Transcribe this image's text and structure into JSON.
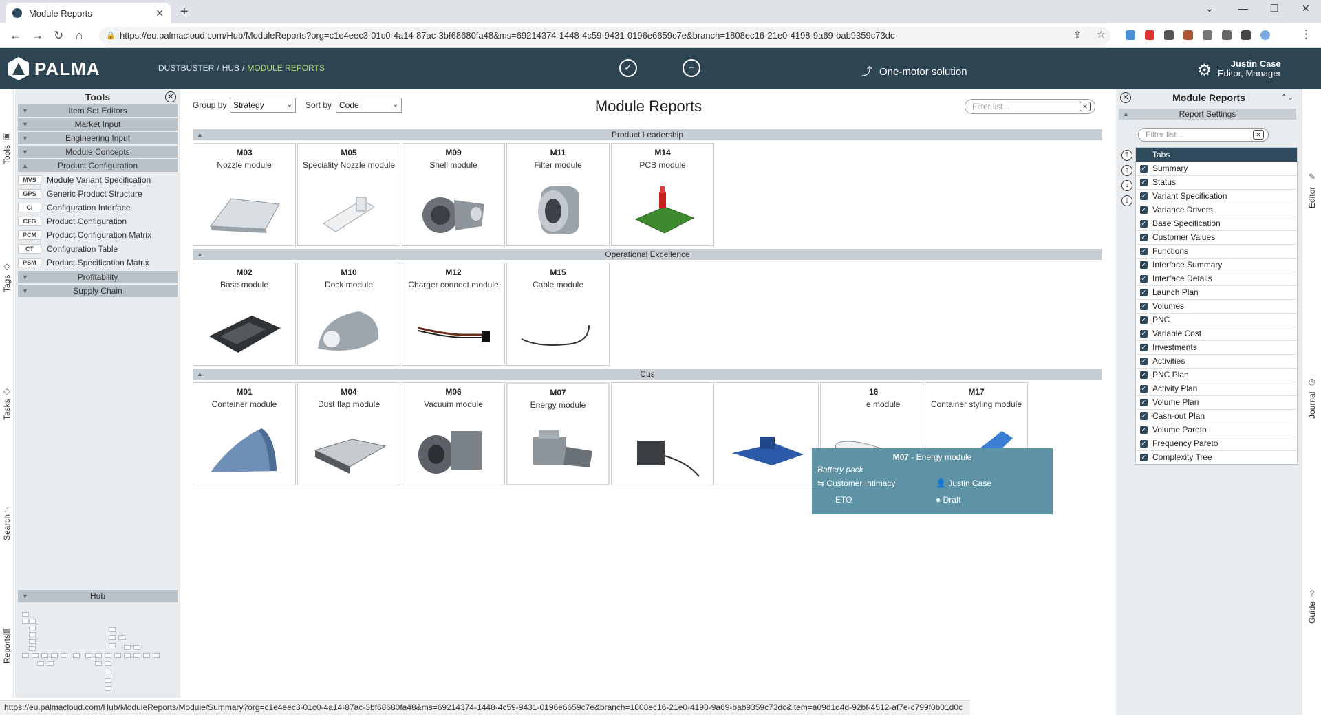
{
  "browser": {
    "tab_title": "Module Reports",
    "url": "https://eu.palmacloud.com/Hub/ModuleReports?org=c1e4eec3-01c0-4a14-87ac-3bf68680fa48&ms=69214374-1448-4c59-9431-0196e6659c7e&branch=1808ec16-21e0-4198-9a69-bab9359c73dc"
  },
  "header": {
    "logo": "PALMA",
    "breadcrumb": [
      "DUSTBUSTER",
      "HUB",
      "MODULE REPORTS"
    ],
    "solution": "One-motor solution",
    "user_name": "Justin Case",
    "user_role": "Editor, Manager"
  },
  "left_rail": [
    "Tools",
    "Tags",
    "Tasks",
    "Search",
    "Reports"
  ],
  "tools": {
    "title": "Tools",
    "groups_top": [
      "Item Set Editors",
      "Market Input",
      "Engineering Input",
      "Module Concepts",
      "Product Configuration"
    ],
    "items": [
      {
        "code": "MVS",
        "label": "Module Variant Specification"
      },
      {
        "code": "GPS",
        "label": "Generic Product Structure"
      },
      {
        "code": "CI",
        "label": "Configuration Interface"
      },
      {
        "code": "CFG",
        "label": "Product Configuration"
      },
      {
        "code": "PCM",
        "label": "Product Configuration Matrix"
      },
      {
        "code": "CT",
        "label": "Configuration Table"
      },
      {
        "code": "PSM",
        "label": "Product Specification Matrix"
      }
    ],
    "groups_bottom": [
      "Profitability",
      "Supply Chain"
    ],
    "hub": "Hub"
  },
  "main": {
    "group_by_label": "Group by",
    "group_by_value": "Strategy",
    "sort_by_label": "Sort by",
    "sort_by_value": "Code",
    "title": "Module Reports",
    "filter_placeholder": "Filter list...",
    "sections": [
      {
        "name": "Product Leadership",
        "modules": [
          {
            "code": "M03",
            "name": "Nozzle module"
          },
          {
            "code": "M05",
            "name": "Speciality Nozzle module"
          },
          {
            "code": "M09",
            "name": "Shell module"
          },
          {
            "code": "M11",
            "name": "Filter module"
          },
          {
            "code": "M14",
            "name": "PCB module"
          }
        ]
      },
      {
        "name": "Operational Excellence",
        "modules": [
          {
            "code": "M02",
            "name": "Base module"
          },
          {
            "code": "M10",
            "name": "Dock module"
          },
          {
            "code": "M12",
            "name": "Charger connect module"
          },
          {
            "code": "M15",
            "name": "Cable module"
          }
        ]
      },
      {
        "name": "Cus",
        "modules": [
          {
            "code": "M01",
            "name": "Container module"
          },
          {
            "code": "M04",
            "name": "Dust flap module"
          },
          {
            "code": "M06",
            "name": "Vacuum module"
          },
          {
            "code": "M07",
            "name": "Energy module"
          },
          {
            "code": "",
            "name": ""
          },
          {
            "code": "",
            "name": ""
          },
          {
            "code": "16",
            "name": "e module"
          },
          {
            "code": "M17",
            "name": "Container styling module"
          }
        ]
      }
    ],
    "tooltip": {
      "code": "M07",
      "name": "Energy module",
      "subtitle": "Battery pack",
      "strategy": "Customer Intimacy",
      "owner": "Justin Case",
      "type": "ETO",
      "status": "Draft"
    }
  },
  "right_panel": {
    "title": "Module Reports",
    "settings": "Report Settings",
    "filter_placeholder": "Filter list...",
    "tabs_header": "Tabs",
    "tabs": [
      "Summary",
      "Status",
      "Variant Specification",
      "Variance Drivers",
      "Base Specification",
      "Customer Values",
      "Functions",
      "Interface Summary",
      "Interface Details",
      "Launch Plan",
      "Volumes",
      "PNC",
      "Variable Cost",
      "Investments",
      "Activities",
      "PNC Plan",
      "Activity Plan",
      "Volume Plan",
      "Cash-out Plan",
      "Volume Pareto",
      "Frequency Pareto",
      "Complexity Tree"
    ]
  },
  "right_rail": [
    "Editor",
    "Journal",
    "Guide"
  ],
  "status_url": "https://eu.palmacloud.com/Hub/ModuleReports/Module/Summary?org=c1e4eec3-01c0-4a14-87ac-3bf68680fa48&ms=69214374-1448-4c59-9431-0196e6659c7e&branch=1808ec16-21e0-4198-9a69-bab9359c73dc&item=a09d1d4d-92bf-4512-af7e-c799f0b01d0c"
}
